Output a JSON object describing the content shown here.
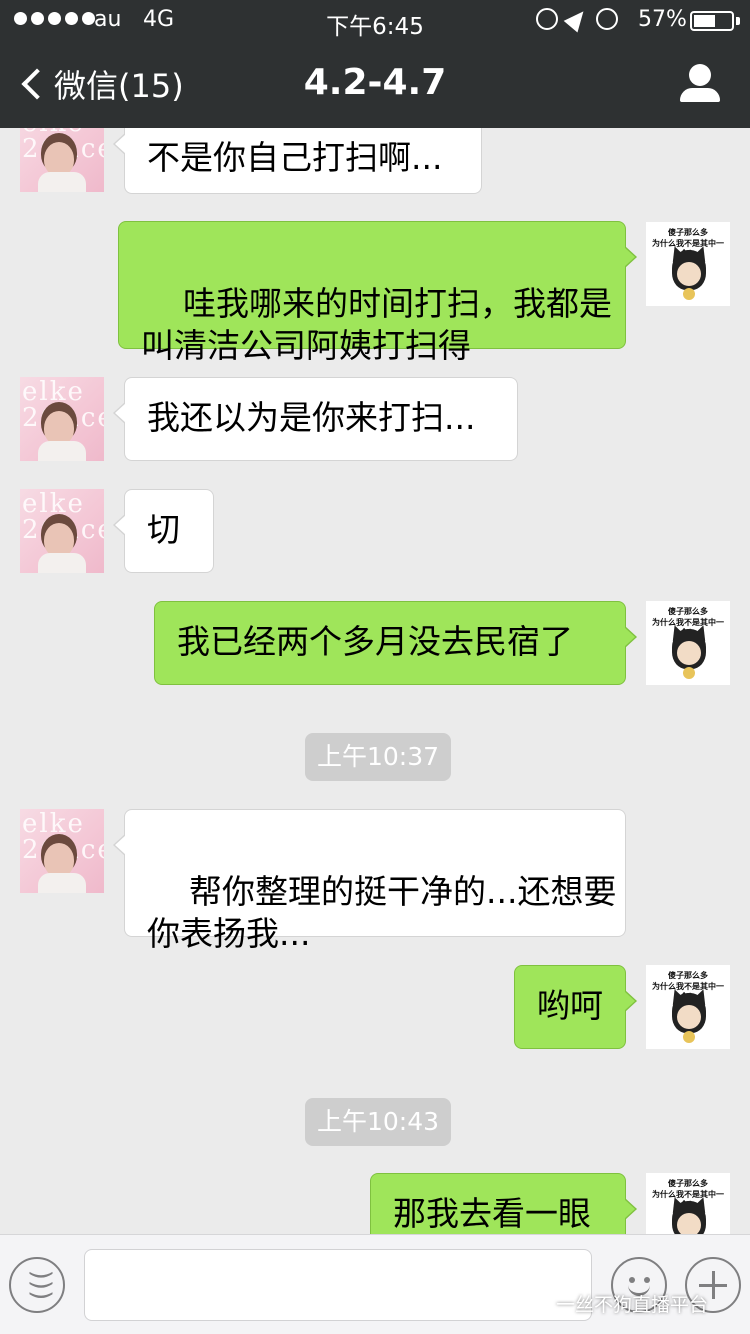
{
  "status_bar": {
    "carrier": "au",
    "network": "4G",
    "time": "下午6:45",
    "battery_percent": "57%",
    "battery_level": 0.57,
    "icons": [
      "rotation-lock-icon",
      "location-arrow-icon",
      "alarm-icon"
    ]
  },
  "nav": {
    "back_label": "微信(15)",
    "title": "4.2-4.7",
    "profile_icon": "person-icon"
  },
  "messages": [
    {
      "from": "them",
      "text": "不是你自己打扫啊..."
    },
    {
      "from": "me",
      "text": "哇我哪来的时间打扫，我都是\n叫清洁公司阿姨打扫得"
    },
    {
      "from": "them",
      "text": "我还以为是你来打扫..."
    },
    {
      "from": "them",
      "text": "切"
    },
    {
      "from": "me",
      "text": "我已经两个多月没去民宿了"
    },
    {
      "type": "time",
      "text": "上午10:37"
    },
    {
      "from": "them",
      "text": "帮你整理的挺干净的...还想要\n你表扬我..."
    },
    {
      "from": "me",
      "text": "哟呵"
    },
    {
      "type": "time",
      "text": "上午10:43"
    },
    {
      "from": "me",
      "text": "那我去看一眼"
    }
  ],
  "avatars": {
    "them_text": "elke\n2Gace",
    "me_caption_1": "傻子那么多",
    "me_caption_2": "为什么我不是其中一个？"
  },
  "input_bar": {
    "voice_icon": "voice-icon",
    "emoji_icon": "emoji-icon",
    "plus_icon": "plus-icon",
    "input_value": ""
  },
  "watermark": "一丝不狗直播平台",
  "colors": {
    "nav_bg": "#2e3132",
    "chat_bg": "#ebebeb",
    "bubble_out": "#9fe55a",
    "bubble_in": "#ffffff"
  }
}
